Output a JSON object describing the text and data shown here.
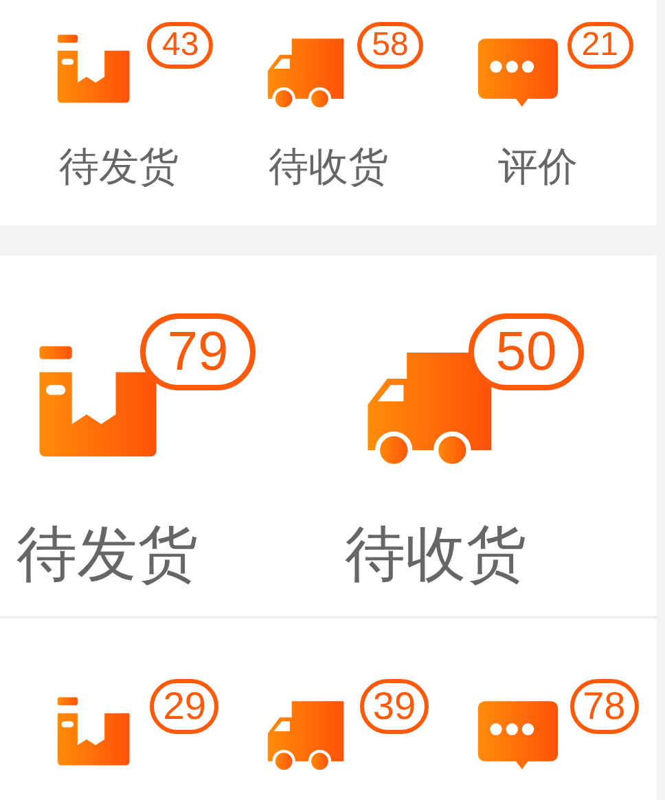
{
  "sections": [
    {
      "items": [
        {
          "kind": "box",
          "count": "43",
          "label": "待发货"
        },
        {
          "kind": "truck",
          "count": "58",
          "label": "待收货"
        },
        {
          "kind": "chat",
          "count": "21",
          "label": "评价"
        }
      ]
    },
    {
      "items": [
        {
          "kind": "box",
          "count": "79",
          "label": "待发货"
        },
        {
          "kind": "truck",
          "count": "50",
          "label": "待收货"
        }
      ]
    },
    {
      "items": [
        {
          "kind": "box",
          "count": "29"
        },
        {
          "kind": "truck",
          "count": "39"
        },
        {
          "kind": "chat",
          "count": "78"
        }
      ]
    }
  ]
}
